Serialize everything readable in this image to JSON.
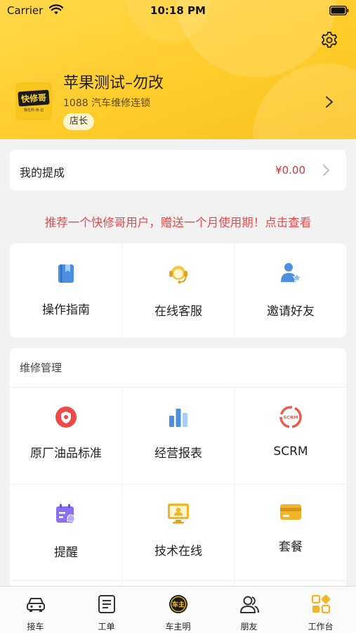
{
  "status_bar": {
    "carrier": "Carrier",
    "time": "10:18 PM"
  },
  "header": {
    "logo_text": "快修哥",
    "logo_sub": "我在你·身·边",
    "shop_name": "苹果测试–勿改",
    "shop_subtitle": "1088 汽车维修连锁",
    "role_badge": "店长"
  },
  "commission": {
    "label": "我的提成",
    "amount": "¥0.00"
  },
  "promo_text": "推荐一个快修哥用户，赠送一个月使用期！点击查看",
  "quick_actions": [
    {
      "label": "操作指南",
      "icon": "book-icon"
    },
    {
      "label": "在线客服",
      "icon": "customer-service-icon"
    },
    {
      "label": "邀请好友",
      "icon": "invite-friend-icon"
    }
  ],
  "repair_section": {
    "title": "维修管理",
    "items": [
      {
        "label": "原厂油品标准",
        "icon": "oil-standard-icon"
      },
      {
        "label": "经营报表",
        "icon": "bar-report-icon"
      },
      {
        "label": "SCRM",
        "icon": "scrm-icon"
      },
      {
        "label": "提醒",
        "icon": "calendar-reminder-icon"
      },
      {
        "label": "技术在线",
        "icon": "tech-online-icon"
      },
      {
        "label": "套餐",
        "icon": "card-package-icon"
      }
    ]
  },
  "tabbar": {
    "tabs": [
      {
        "label": "接车",
        "icon": "car-icon",
        "active": false
      },
      {
        "label": "工单",
        "icon": "work-order-icon",
        "active": false
      },
      {
        "label": "车主明",
        "icon": "owner-logo-icon",
        "active": false
      },
      {
        "label": "朋友",
        "icon": "friends-icon",
        "active": false
      },
      {
        "label": "工作台",
        "icon": "workbench-icon",
        "active": true
      }
    ]
  },
  "colors": {
    "header_yellow": "#ffcc2a",
    "accent_red": "#e02e2e",
    "promo_red": "#f04848",
    "icon_blue": "#4a8fe0",
    "icon_yellow": "#f2b529",
    "icon_purple": "#8a6ff0"
  }
}
